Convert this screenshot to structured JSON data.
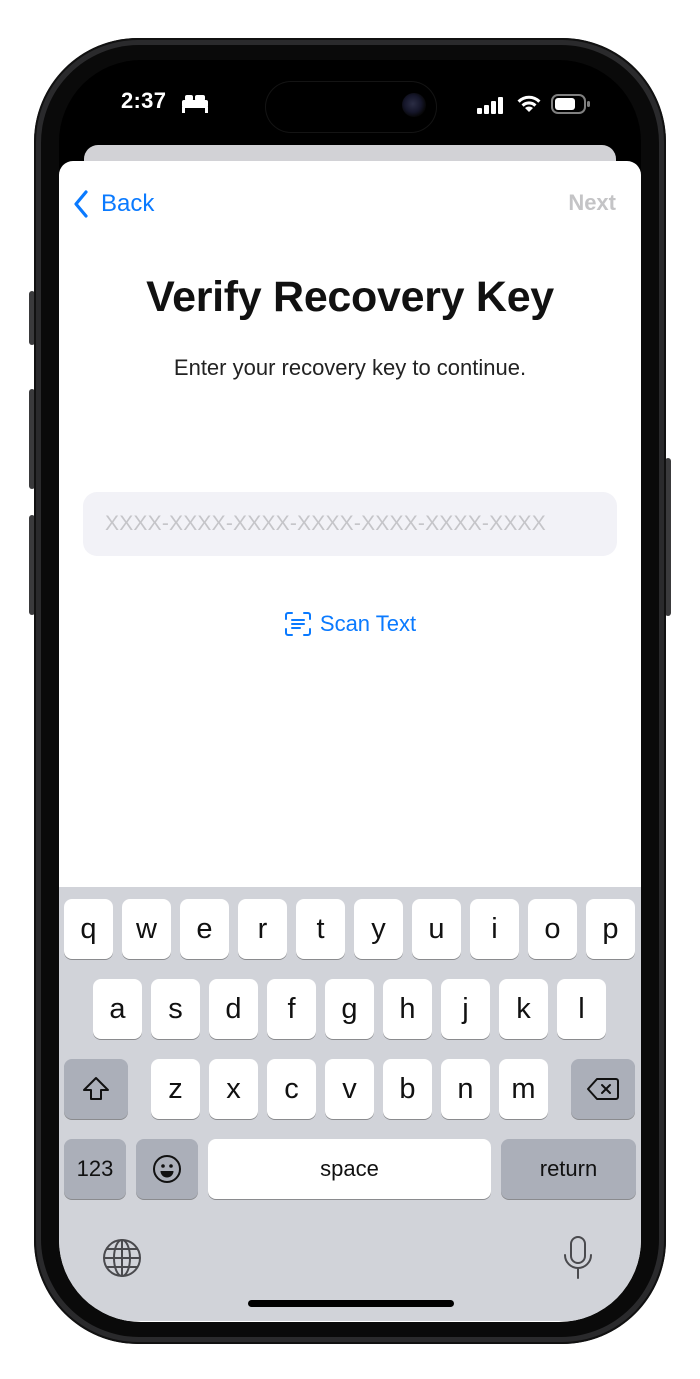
{
  "status_bar": {
    "time": "2:37",
    "time_icon": "bed-icon",
    "icons": [
      "cellular-signal-icon",
      "wifi-icon",
      "battery-icon"
    ]
  },
  "nav": {
    "back_label": "Back",
    "next_label": "Next"
  },
  "content": {
    "title": "Verify Recovery Key",
    "subtitle": "Enter your recovery key to continue.",
    "recovery_key_value": "",
    "recovery_key_placeholder": "XXXX-XXXX-XXXX-XXXX-XXXX-XXXX-XXXX",
    "scan_label": "Scan Text"
  },
  "keyboard": {
    "row1": [
      "q",
      "w",
      "e",
      "r",
      "t",
      "y",
      "u",
      "i",
      "o",
      "p"
    ],
    "row2": [
      "a",
      "s",
      "d",
      "f",
      "g",
      "h",
      "j",
      "k",
      "l"
    ],
    "row3": [
      "z",
      "x",
      "c",
      "v",
      "b",
      "n",
      "m"
    ],
    "numbers_label": "123",
    "space_label": "space",
    "return_label": "return",
    "special_icons": [
      "shift-icon",
      "delete-icon",
      "emoji-icon",
      "globe-icon",
      "microphone-icon"
    ]
  },
  "colors": {
    "accent": "#0a7aff",
    "disabled": "#c4c4c6",
    "field_background": "#f2f2f7",
    "keyboard_background": "#d1d3d9",
    "key_dark": "#abafb9"
  }
}
